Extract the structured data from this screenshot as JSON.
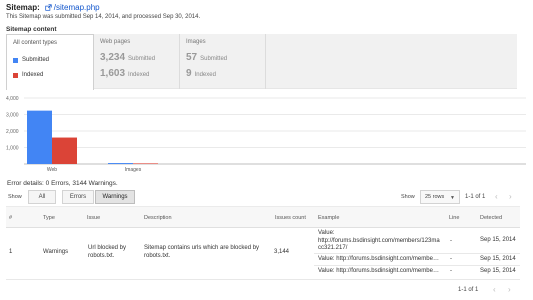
{
  "header": {
    "title": "Sitemap:",
    "sitemap_link": "/sitemap.php",
    "subtitle": "This Sitemap was submitted Sep 14, 2014, and processed Sep 30, 2014."
  },
  "content_section": {
    "title": "Sitemap content",
    "tabs": {
      "all_types": {
        "label": "All content types",
        "legend": [
          {
            "label": "Submitted",
            "color": "#4285f4"
          },
          {
            "label": "Indexed",
            "color": "#db4437"
          }
        ]
      },
      "web_pages": {
        "label": "Web pages",
        "submitted_value": "3,234",
        "submitted_label": "Submitted",
        "indexed_value": "1,603",
        "indexed_label": "Indexed"
      },
      "images": {
        "label": "Images",
        "submitted_value": "57",
        "submitted_label": "Submitted",
        "indexed_value": "9",
        "indexed_label": "Indexed"
      }
    }
  },
  "chart_data": {
    "type": "bar",
    "categories": [
      "Web",
      "Images"
    ],
    "series": [
      {
        "name": "Submitted",
        "values": [
          3234,
          57
        ],
        "color": "#4285f4"
      },
      {
        "name": "Indexed",
        "values": [
          1603,
          9
        ],
        "color": "#db4437"
      }
    ],
    "y_ticks": [
      "4,000",
      "3,000",
      "2,000",
      "1,000"
    ],
    "ylim": [
      0,
      4000
    ],
    "grid": true,
    "legend": "none"
  },
  "errors": {
    "summary": "Error details: 0 Errors, 3144 Warnings.",
    "show_label": "Show",
    "filters": [
      "All",
      "Errors",
      "Warnings"
    ],
    "active_filter": "Warnings",
    "rows_label": "Show",
    "rows_value": "25 rows",
    "pager_text": "1-1 of 1"
  },
  "table": {
    "headers": [
      "#",
      "Type",
      "Issue",
      "Description",
      "Issues count",
      "Example",
      "Line",
      "Detected"
    ],
    "row": {
      "num": "1",
      "type": "Warnings",
      "issue": "Url blocked by robots.txt.",
      "description": "Sitemap contains urls which are blocked by robots.txt.",
      "count": "3,144",
      "examples": [
        {
          "value": "Value: http://forums.bsdinsight.com/members/123ma cc321.217/",
          "line": "-",
          "detected": "Sep 15, 2014"
        },
        {
          "value": "Value: http://forums.bsdinsight.com/membe…",
          "line": "-",
          "detected": "Sep 15, 2014"
        },
        {
          "value": "Value: http://forums.bsdinsight.com/membe…",
          "line": "-",
          "detected": "Sep 15, 2014"
        }
      ]
    }
  },
  "bottom_pager": {
    "text": "1-1 of 1"
  }
}
